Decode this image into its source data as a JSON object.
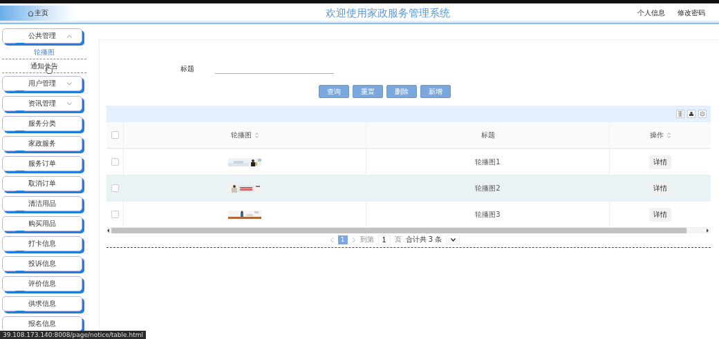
{
  "header": {
    "home": "主页",
    "title": "欢迎使用家政服务管理系统",
    "links": [
      "个人信息",
      "修改密码"
    ]
  },
  "sidebar": {
    "items": [
      {
        "label": "公共管理",
        "kind": "group",
        "expanded": true,
        "children": [
          {
            "label": "轮播图",
            "selected": true,
            "hovered": false
          },
          {
            "label": "通知公告",
            "selected": false,
            "hovered": true
          }
        ]
      },
      {
        "label": "用户管理",
        "kind": "group",
        "expanded": false
      },
      {
        "label": "资讯管理",
        "kind": "group",
        "expanded": false
      },
      {
        "label": "服务分类",
        "kind": "link"
      },
      {
        "label": "家政服务",
        "kind": "link"
      },
      {
        "label": "服务订单",
        "kind": "link"
      },
      {
        "label": "取消订单",
        "kind": "link"
      },
      {
        "label": "清洁用品",
        "kind": "link"
      },
      {
        "label": "购买用品",
        "kind": "link"
      },
      {
        "label": "打卡信息",
        "kind": "link"
      },
      {
        "label": "投诉信息",
        "kind": "link"
      },
      {
        "label": "评价信息",
        "kind": "link"
      },
      {
        "label": "供求信息",
        "kind": "link"
      },
      {
        "label": "报名信息",
        "kind": "link"
      }
    ]
  },
  "search": {
    "label": "标题"
  },
  "buttons": [
    "查询",
    "重置",
    "删除",
    "新增"
  ],
  "table": {
    "select_all_checked": false,
    "columns": [
      {
        "label": "轮播图",
        "sortable": true
      },
      {
        "label": "标题",
        "sortable": false
      },
      {
        "label": "操作",
        "sortable": true
      }
    ],
    "rows": [
      {
        "checked": false,
        "highlighted": false,
        "title": "轮播图1",
        "action": "详情"
      },
      {
        "checked": false,
        "highlighted": true,
        "title": "轮播图2",
        "action": "详情"
      },
      {
        "checked": false,
        "highlighted": false,
        "title": "轮播图3",
        "action": "详情"
      }
    ]
  },
  "pagination": {
    "pages": [
      {
        "label": "1",
        "selected": true
      }
    ],
    "goto_label": "到第",
    "goto_value": "1",
    "page_unit": "页",
    "total": "合计共 3 条"
  },
  "status_bar": {
    "url": "39.108.173.140:8008/page/notice/table.html"
  }
}
